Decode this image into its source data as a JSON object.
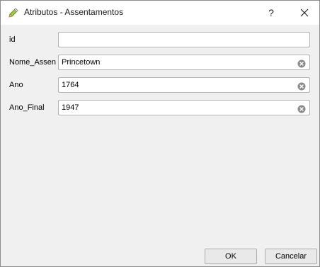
{
  "window": {
    "title": "Atributos - Assentamentos",
    "help_label": "?",
    "icon": "edit-pencil-icon"
  },
  "fields": [
    {
      "label": "id",
      "value": ""
    },
    {
      "label": "Nome_Assen",
      "value": "Princetown"
    },
    {
      "label": "Ano",
      "value": "1764"
    },
    {
      "label": "Ano_Final",
      "value": "1947"
    }
  ],
  "buttons": {
    "ok_label": "OK",
    "cancel_label": "Cancelar"
  }
}
